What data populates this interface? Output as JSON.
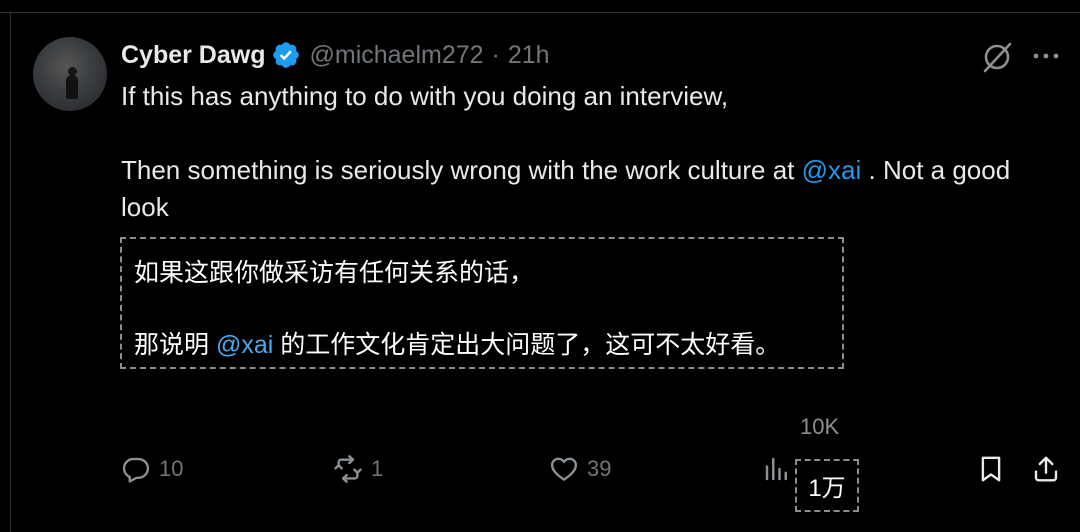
{
  "tweet": {
    "author_name": "Cyber Dawg",
    "handle": "@michaelm272",
    "separator": "·",
    "time": "21h",
    "verified_color": "#1d9bf0",
    "text_line1": "If this has anything to do with you doing an interview,",
    "text_line2_before": "Then something is seriously wrong with the work culture at ",
    "text_line2_mention": "@xai",
    "text_line2_after": " . Not a good look"
  },
  "translation": {
    "line1": "如果这跟你做采访有任何关系的话，",
    "line2_before": "那说明 ",
    "line2_mention": "@xai",
    "line2_after": " 的工作文化肯定出大问题了，这可不太好看。"
  },
  "actions": {
    "reply_count": "10",
    "retweet_count": "1",
    "like_count": "39",
    "views_count": "10K",
    "views_translation": "1万"
  },
  "icons": {
    "avatar": "avatar",
    "verified": "verified-badge-icon",
    "grok": "grok-icon",
    "more": "more-icon",
    "reply": "reply-icon",
    "retweet": "retweet-icon",
    "like": "like-icon",
    "views": "views-icon",
    "bookmark": "bookmark-icon",
    "share": "share-icon"
  },
  "colors": {
    "background": "#000000",
    "text": "#e7e9ea",
    "muted": "#71767b",
    "mention": "#1d9bf0"
  }
}
